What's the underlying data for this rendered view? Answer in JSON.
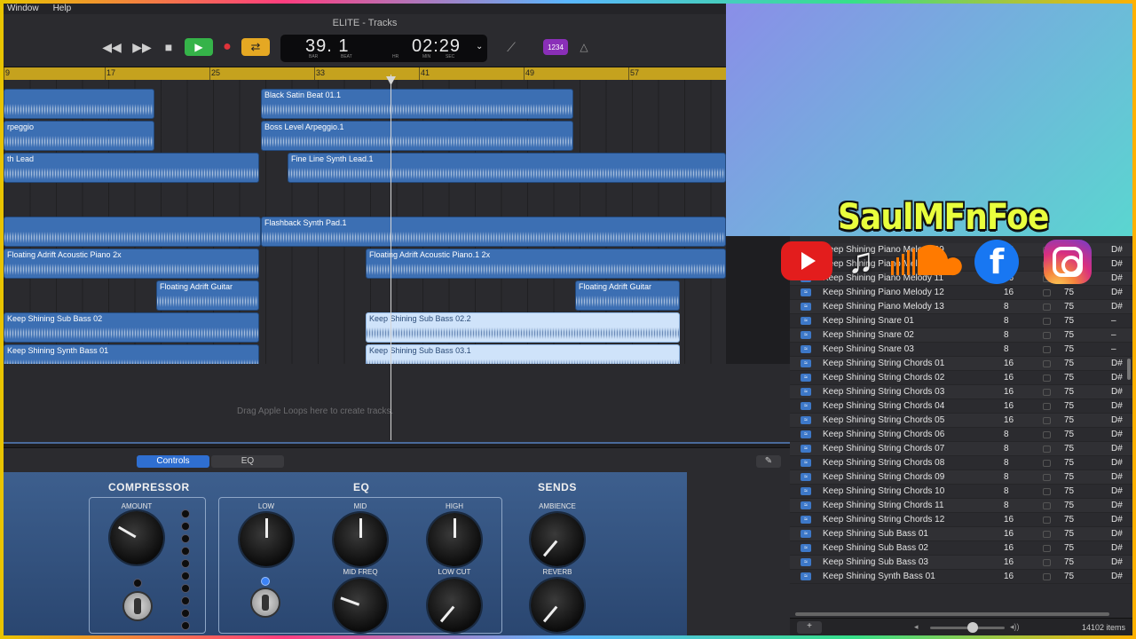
{
  "menubar": {
    "items": [
      "Window",
      "Help"
    ]
  },
  "toolbar": {
    "title": "ELITE - Tracks",
    "lcd": {
      "bars": "39. 1",
      "time": "02:29",
      "bar_label": "BAR",
      "beat_label": "BEAT",
      "hr_label": "HR",
      "min_label": "MIN",
      "sec_label": "SEC"
    },
    "count_in": "1234",
    "icons": {
      "rewind": "rewind-icon",
      "forward": "fast-forward-icon",
      "stop": "stop-icon",
      "play": "play-icon",
      "record": "record-icon",
      "cycle": "cycle-icon",
      "tuner": "tuner-icon",
      "metronome": "metronome-icon"
    }
  },
  "ruler": {
    "marks": [
      "9",
      "17",
      "25",
      "33",
      "41",
      "49",
      "57"
    ]
  },
  "regions": [
    {
      "label": "",
      "sel": false
    },
    {
      "label": "Black Satin Beat 01.1",
      "sel": false
    },
    {
      "label": "rpeggio",
      "sel": false
    },
    {
      "label": "Boss Level Arpeggio.1",
      "sel": false
    },
    {
      "label": "th Lead",
      "sel": false
    },
    {
      "label": "Fine Line Synth Lead.1",
      "sel": false
    },
    {
      "label": "",
      "sel": false
    },
    {
      "label": "Flashback Synth Pad.1",
      "sel": false
    },
    {
      "label": "Floating Adrift Acoustic Piano  2x",
      "sel": false
    },
    {
      "label": "Floating Adrift Acoustic Piano.1  2x",
      "sel": false
    },
    {
      "label": "Floating Adrift Guitar",
      "sel": false
    },
    {
      "label": "Floating Adrift Guitar",
      "sel": false
    },
    {
      "label": "Keep Shining Sub Bass 02",
      "sel": false
    },
    {
      "label": "Keep Shining Sub Bass 02.2",
      "sel": true
    },
    {
      "label": "Keep Shining Synth Bass 01",
      "sel": false
    },
    {
      "label": "Keep Shining Sub Bass 03.1",
      "sel": true
    }
  ],
  "tracks_hint": "Drag Apple Loops here to create tracks.",
  "smart": {
    "tabs": [
      "Controls",
      "EQ"
    ],
    "compressor": {
      "title": "COMPRESSOR",
      "amount": "AMOUNT"
    },
    "eq": {
      "title": "EQ",
      "low": "LOW",
      "mid": "MID",
      "high": "HIGH",
      "mid_freq": "MID FREQ",
      "low_cut": "LOW CUT"
    },
    "sends": {
      "title": "SENDS",
      "ambience": "AMBIENCE",
      "reverb": "REVERB"
    }
  },
  "browser": {
    "rows": [
      {
        "name": "Keep Shining Piano Melody 09",
        "beats": "16",
        "tempo": "75",
        "key": "D#"
      },
      {
        "name": "Keep Shining Piano Melody 10",
        "beats": "16",
        "tempo": "75",
        "key": "D#"
      },
      {
        "name": "Keep Shining Piano Melody 11",
        "beats": "16",
        "tempo": "75",
        "key": "D#"
      },
      {
        "name": "Keep Shining Piano Melody 12",
        "beats": "16",
        "tempo": "75",
        "key": "D#"
      },
      {
        "name": "Keep Shining Piano Melody 13",
        "beats": "8",
        "tempo": "75",
        "key": "D#"
      },
      {
        "name": "Keep Shining Snare 01",
        "beats": "8",
        "tempo": "75",
        "key": "–"
      },
      {
        "name": "Keep Shining Snare 02",
        "beats": "8",
        "tempo": "75",
        "key": "–"
      },
      {
        "name": "Keep Shining Snare 03",
        "beats": "8",
        "tempo": "75",
        "key": "–"
      },
      {
        "name": "Keep Shining String Chords 01",
        "beats": "16",
        "tempo": "75",
        "key": "D#"
      },
      {
        "name": "Keep Shining String Chords 02",
        "beats": "16",
        "tempo": "75",
        "key": "D#"
      },
      {
        "name": "Keep Shining String Chords 03",
        "beats": "16",
        "tempo": "75",
        "key": "D#"
      },
      {
        "name": "Keep Shining String Chords 04",
        "beats": "16",
        "tempo": "75",
        "key": "D#"
      },
      {
        "name": "Keep Shining String Chords 05",
        "beats": "16",
        "tempo": "75",
        "key": "D#"
      },
      {
        "name": "Keep Shining String Chords 06",
        "beats": "8",
        "tempo": "75",
        "key": "D#"
      },
      {
        "name": "Keep Shining String Chords 07",
        "beats": "8",
        "tempo": "75",
        "key": "D#"
      },
      {
        "name": "Keep Shining String Chords 08",
        "beats": "8",
        "tempo": "75",
        "key": "D#"
      },
      {
        "name": "Keep Shining String Chords 09",
        "beats": "8",
        "tempo": "75",
        "key": "D#"
      },
      {
        "name": "Keep Shining String Chords 10",
        "beats": "8",
        "tempo": "75",
        "key": "D#"
      },
      {
        "name": "Keep Shining String Chords 11",
        "beats": "8",
        "tempo": "75",
        "key": "D#"
      },
      {
        "name": "Keep Shining String Chords 12",
        "beats": "16",
        "tempo": "75",
        "key": "D#"
      },
      {
        "name": "Keep Shining Sub Bass 01",
        "beats": "16",
        "tempo": "75",
        "key": "D#"
      },
      {
        "name": "Keep Shining Sub Bass 02",
        "beats": "16",
        "tempo": "75",
        "key": "D#"
      },
      {
        "name": "Keep Shining Sub Bass 03",
        "beats": "16",
        "tempo": "75",
        "key": "D#"
      },
      {
        "name": "Keep Shining Synth Bass 01",
        "beats": "16",
        "tempo": "75",
        "key": "D#"
      }
    ],
    "item_count": "14102 items"
  },
  "overlay": {
    "brand": "SaulMFnFoe",
    "socials": [
      "youtube-icon",
      "apple-music-icon",
      "soundcloud-icon",
      "facebook-icon",
      "instagram-icon"
    ],
    "facebook_glyph": "f"
  },
  "colors": {
    "region": "#3c6fb3",
    "ruler": "#c5a21e",
    "play": "#35b349",
    "cycle": "#e5a823",
    "brand": "#e9ff3d"
  }
}
